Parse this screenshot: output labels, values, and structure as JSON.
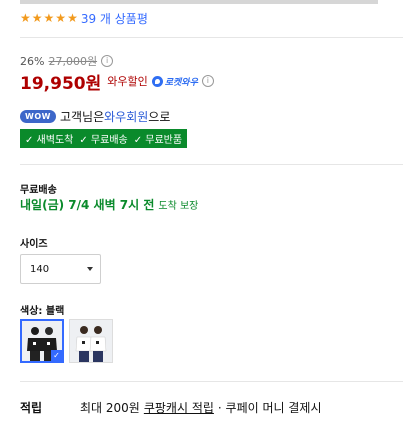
{
  "rating": {
    "stars": 5,
    "review_count": "39 개 상품평"
  },
  "price": {
    "discount_pct": "26%",
    "original": "27,000원",
    "info_icon": "i",
    "sale": "19,950원",
    "wow_sale": "와우할인",
    "rocket_wow": "로켓와우"
  },
  "wow": {
    "pill": "WOW",
    "text_before": "고객님은",
    "member": "와우회원",
    "text_after": "으로"
  },
  "benefits": [
    "✓ 새벽도착",
    "✓ 무료배송",
    "✓ 무료반품"
  ],
  "shipping": {
    "label": "무료배송",
    "date": "내일(금) 7/4 새벽 7시 전",
    "guarantee": "도착 보장"
  },
  "size": {
    "label": "사이즈",
    "selected": "140"
  },
  "color": {
    "label": "색상: 블랙",
    "options": [
      {
        "name": "블랙",
        "selected": true,
        "shirt": "#1c1c1c",
        "pants": "#222222"
      },
      {
        "name": "화이트",
        "selected": false,
        "shirt": "#ffffff",
        "pants": "#2a3560"
      }
    ],
    "check": "✓"
  },
  "accumulate": {
    "label": "적립",
    "text_before": "최대 200원",
    "link": "쿠팡캐시 적립",
    "text_after": "· 쿠페이 머니 결제시"
  },
  "colors": {
    "accent": "#346aff",
    "sale": "#ae0000",
    "green": "#0a8a2b",
    "star": "#f29a1d"
  }
}
